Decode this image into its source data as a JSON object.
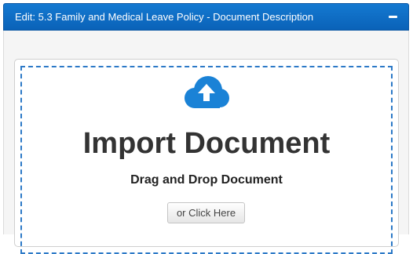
{
  "header": {
    "title": "Edit: 5.3 Family and Medical Leave Policy - Document Description",
    "collapse_icon": "minus-icon"
  },
  "dropzone": {
    "icon": "cloud-upload-icon",
    "title": "Import Document",
    "subtitle": "Drag and Drop Document",
    "button_label": "or Click Here"
  },
  "colors": {
    "header_bg": "#0a6cc4",
    "icon": "#1a82d6",
    "dash_border": "#2c79c7"
  }
}
